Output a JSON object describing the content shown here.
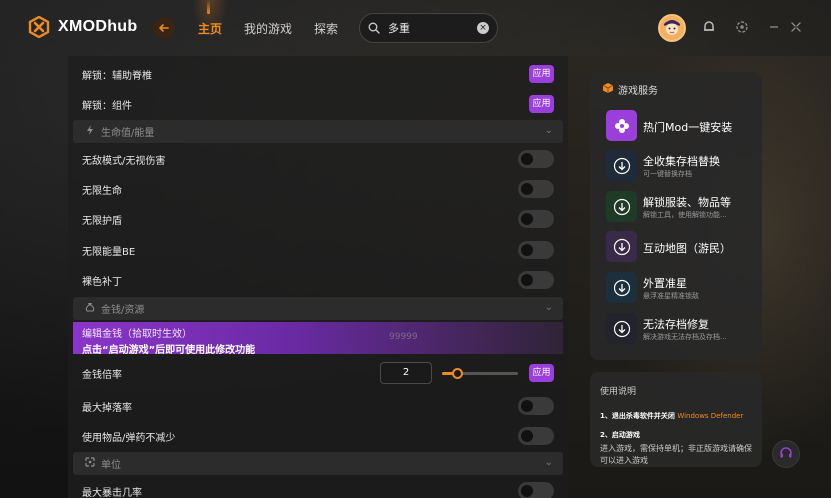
{
  "app": {
    "logo_text": "XMODhub"
  },
  "nav": {
    "tabs": [
      "主页",
      "我的游戏",
      "探索"
    ]
  },
  "search": {
    "value": "多重"
  },
  "mods": {
    "unlock_rows": [
      {
        "label": "解锁：辅助脊椎",
        "button": "应用"
      },
      {
        "label": "解锁：组件",
        "button": "应用"
      }
    ],
    "section_health": "生命值/能量",
    "health_rows": [
      "无敌模式/无视伤害",
      "无限生命",
      "无限护盾",
      "无限能量BE",
      "裸色补丁"
    ],
    "section_money": "金钱/资源",
    "money_highlight": {
      "line1": "编辑金钱（拾取时生效）",
      "line2": "点击“启动游戏”后即可使用此修改功能",
      "ghost": "99999"
    },
    "money_rate": {
      "label": "金钱倍率",
      "value": "2",
      "button": "应用",
      "slider_fraction": 0.2
    },
    "money_rows": [
      "最大掉落率",
      "使用物品/弹药不减少"
    ],
    "section_unit": "单位",
    "unit_rows": [
      "最大暴击几率"
    ]
  },
  "services": {
    "title": "游戏服务",
    "items": [
      {
        "name": "热门Mod一键安装",
        "desc": ""
      },
      {
        "name": "全收集存档替换",
        "desc": "可一键替换存档"
      },
      {
        "name": "解锁服装、物品等",
        "desc": "解锁工具，使用解锁功能..."
      },
      {
        "name": "互动地图（游民）",
        "desc": ""
      },
      {
        "name": "外置准星",
        "desc": "悬浮准星精准锁敌"
      },
      {
        "name": "无法存档修复",
        "desc": "解决游戏无法存档及存档..."
      }
    ]
  },
  "instructions": {
    "title": "使用说明",
    "step1_prefix": "1、退出杀毒软件并关闭",
    "step1_highlight": "Windows Defender",
    "step2_title": "2、启动游戏",
    "step2_desc": "进入游戏，需保持单机；非正版游戏请确保可以进入游戏"
  },
  "colors": {
    "accent": "#f08a24",
    "purple": "#9a3fdc"
  }
}
